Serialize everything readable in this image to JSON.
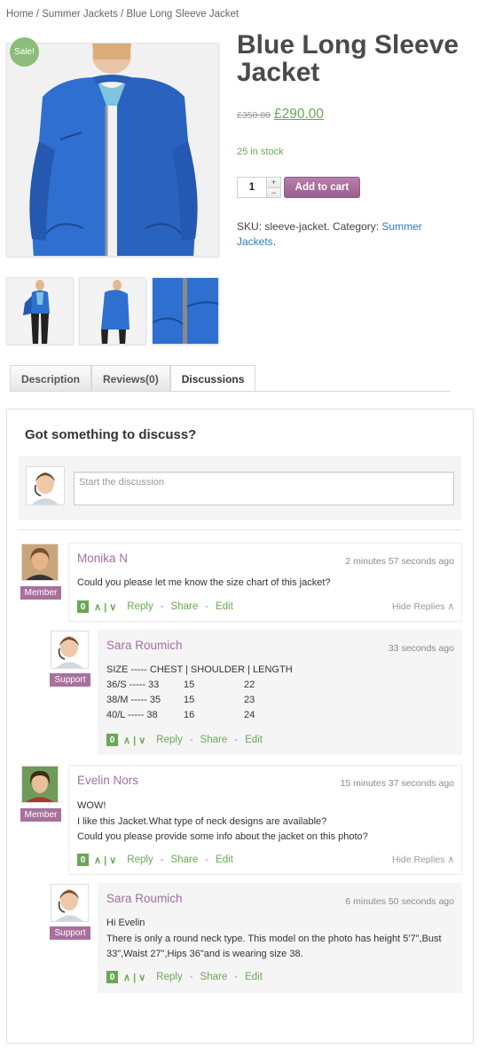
{
  "breadcrumb": "Home / Summer Jackets / Blue Long Sleeve Jacket",
  "product": {
    "sale_badge": "Sale!",
    "title": "Blue Long Sleeve Jacket",
    "old_price": "£350.00",
    "new_price": "£290.00",
    "stock": "25 in stock",
    "quantity": "1",
    "qty_up": "+",
    "qty_down": "−",
    "add_to_cart": "Add to cart",
    "sku_prefix": "SKU: sleeve-jacket. Category: ",
    "category_link": "Summer Jackets",
    "category_suffix": "."
  },
  "tabs": [
    "Description",
    "Reviews(0)",
    "Discussions"
  ],
  "discussion": {
    "heading": "Got something to discuss?",
    "placeholder": "Start the discussion"
  },
  "comments": [
    {
      "name": "Monika N",
      "role": "Member",
      "time": "2 minutes 57 seconds ago",
      "text": [
        "Could you please let me know the size chart of this jacket?"
      ],
      "votes": "0",
      "hide_label": "Hide Replies"
    },
    {
      "name": "Sara Roumich",
      "role": "Support",
      "time": "33 seconds ago",
      "size_chart": {
        "header": "SIZE ----- CHEST | SHOULDER | LENGTH",
        "rows": [
          [
            "36/S ----- 33",
            "15",
            "22"
          ],
          [
            "38/M ----- 35",
            "15",
            "23"
          ],
          [
            "40/L ----- 38",
            "16",
            "24"
          ]
        ]
      },
      "votes": "0"
    },
    {
      "name": "Evelin Nors",
      "role": "Member",
      "time": "15 minutes 37 seconds ago",
      "text": [
        "WOW!",
        "I like this Jacket.What type of neck designs are available?",
        "Could you please provide some info about the jacket on this photo?"
      ],
      "votes": "0",
      "hide_label": "Hide Replies"
    },
    {
      "name": "Sara Roumich",
      "role": "Support",
      "time": "6 minutes 50 seconds ago",
      "text": [
        "Hi Evelin",
        "There is only a round neck type. This model on the photo has height 5'7\",Bust",
        "33\",Waist 27\",Hips 36\"and is wearing size 38."
      ],
      "votes": "0"
    }
  ],
  "actions": {
    "vote_arrows": "∧ | ∨",
    "reply": "Reply",
    "share": "Share",
    "edit": "Edit",
    "separator": "-",
    "hide_arrow": "∧"
  },
  "colors": {
    "accent_green": "#6aa757",
    "role_purple": "#a8709c",
    "name_purple": "#a070a0",
    "link_blue": "#2a7bc0",
    "jacket_blue": "#2f6fd0"
  }
}
